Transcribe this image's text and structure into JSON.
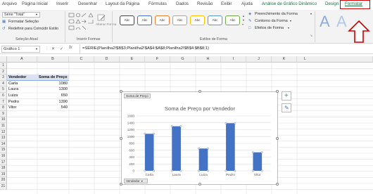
{
  "tabs": [
    "Arquivo",
    "Página Inicial",
    "Inserir",
    "Desenhar",
    "Layout da Página",
    "Fórmulas",
    "Dados",
    "Revisão",
    "Exibir",
    "Ajuda",
    "Análise de Gráfico Dinâmico",
    "Design",
    "Formatar"
  ],
  "ribbon": {
    "selection_value": "Série \"Total\"",
    "format_selection": "Formatar Seleção",
    "reset_style": "Redefinir para Coincidir Estilo",
    "group_selection": "Seleção Atual",
    "group_insert": "Inserir Formas",
    "change_shape": "Alterar Forma",
    "shape_styles": [
      "Abc",
      "Abc",
      "Abc",
      "Abc",
      "Abc",
      "Abc",
      "Abc"
    ],
    "shape_fill": "Preenchimento da Forma",
    "shape_outline": "Contorno da Forma",
    "shape_effects": "Efeitos de Forma",
    "group_shape_styles": "Estilos de Forma",
    "wordart_letter": "A"
  },
  "formula_bar": {
    "name_box": "Gráfico 1",
    "formula": "=SÉRIE(Planilha2!$B$3;Planilha2!$A$4:$A$8;Planilha2!$B$4:$B$8;1)"
  },
  "columns": [
    "A",
    "B",
    "C",
    "D",
    "E",
    "F",
    "G",
    "H",
    "I",
    "J",
    "K",
    "L"
  ],
  "rows": [
    "1",
    "2",
    "3",
    "4",
    "5",
    "6",
    "7",
    "8",
    "9",
    "10",
    "11",
    "12",
    "13",
    "14",
    "15",
    "16",
    "17",
    "18",
    "19",
    "20",
    "21"
  ],
  "table": {
    "header": [
      "Vendedor",
      "Soma de Preço"
    ],
    "rows": [
      {
        "name": "Carla",
        "value": "1080"
      },
      {
        "name": "Laura",
        "value": "1300"
      },
      {
        "name": "Luiza",
        "value": "650"
      },
      {
        "name": "Pedro",
        "value": "1390"
      },
      {
        "name": "Vitor",
        "value": "540"
      }
    ]
  },
  "chart_tags": {
    "series_tag": "Soma de Preço",
    "field_tag": "Vendedor"
  },
  "chart_data": {
    "type": "bar",
    "title": "Soma de Preço por Vendedor",
    "categories": [
      "Carla",
      "Laura",
      "Luiza",
      "Pedro",
      "Vitor"
    ],
    "values": [
      1080,
      1300,
      650,
      1390,
      540
    ],
    "ylim": [
      0,
      1600
    ],
    "yticks": [
      "0",
      "200",
      "400",
      "600",
      "800",
      "1000",
      "1200",
      "1400",
      "1600"
    ],
    "color": "#4472c4",
    "grid": true,
    "legend": "none"
  },
  "colors": {
    "accent": "#1e7145",
    "highlight": "#c00000",
    "bar": "#4472c4"
  }
}
